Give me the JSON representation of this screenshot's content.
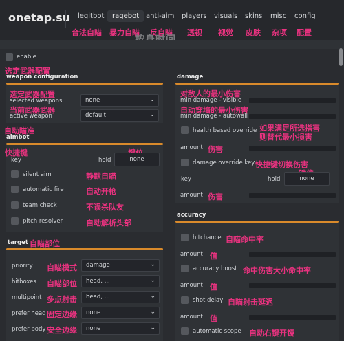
{
  "header": {
    "logo": "onetap.su",
    "tabs": [
      {
        "label": "legitbot",
        "cn": "合法自瞄"
      },
      {
        "label": "ragebot",
        "cn": "暴力自瞄"
      },
      {
        "label": "anti-aim",
        "cn": "反自瞄"
      },
      {
        "label": "players",
        "cn": "透视"
      },
      {
        "label": "visuals",
        "cn": "视觉"
      },
      {
        "label": "skins",
        "cn": "皮肤"
      },
      {
        "label": "misc",
        "cn": "杂项"
      },
      {
        "label": "config",
        "cn": "配置"
      }
    ],
    "active_tab": "ragebot",
    "bg_text": "按身时间"
  },
  "enable": {
    "label": "enable"
  },
  "weapon": {
    "cn_title": "选定武器配置",
    "title": "weapon configuration",
    "cn_selected": "选定武器配置",
    "selected_label": "selected weapons",
    "selected_value": "none",
    "cn_active": "当前武器武器",
    "active_label": "active weapon",
    "active_value": "default"
  },
  "aimbot": {
    "cn_title": "自动瞄准",
    "title": "aimbot",
    "cn_key": "快捷键",
    "key_label": "key",
    "hold_label": "hold",
    "cn_keyval": "键位",
    "key_value": "none",
    "items": [
      {
        "label": "silent aim",
        "cn": "静默自瞄"
      },
      {
        "label": "automatic fire",
        "cn": "自动开枪"
      },
      {
        "label": "team check",
        "cn": "不误杀队友"
      },
      {
        "label": "pitch resolver",
        "cn": "自动解析头部"
      }
    ]
  },
  "target": {
    "title": "target",
    "cn_title": "自瞄部位",
    "rows": [
      {
        "label": "priority",
        "cn": "自瞄模式",
        "value": "damage"
      },
      {
        "label": "hitboxes",
        "cn": "自瞄部位",
        "value": "head, ..."
      },
      {
        "label": "multipoint",
        "cn": "多点射击",
        "value": "head, ..."
      },
      {
        "label": "prefer head",
        "cn": "固定边缘",
        "value": "none"
      },
      {
        "label": "prefer body",
        "cn": "安全边缘",
        "value": "none"
      }
    ]
  },
  "damage": {
    "title": "damage",
    "cn_min": "对敌人的最小伤害",
    "min_visible_label": "min damage - visible",
    "cn_autowall": "自动穿墙的最小伤害",
    "min_autowall_label": "min damage - autowall",
    "health_label": "health based override",
    "cn_health": "如果满足所选指害",
    "cn_health2": "则替代最小损害",
    "amount_label": "amount",
    "cn_amount": "伤害",
    "override_key_label": "damage override key",
    "cn_override_key": "快捷键切换伤害",
    "cn_keyval": "键位",
    "key_label": "key",
    "hold_label": "hold",
    "key_value": "none",
    "amount2_label": "amount",
    "cn_amount2": "伤害"
  },
  "accuracy": {
    "title": "accuracy",
    "hitchance_label": "hitchance",
    "cn_hitchance": "自瞄命中率",
    "amount_label": "amount",
    "cn_value": "值",
    "boost_label": "accuracy boost",
    "cn_boost": "命中伤害大小命中率",
    "shot_delay_label": "shot delay",
    "cn_shot_delay": "自瞄射击延迟",
    "auto_scope_label": "automatic scope",
    "cn_auto_scope": "自动右键开镜"
  },
  "colors": {
    "accent": "#d98a2b",
    "annotation": "#e8327f"
  }
}
